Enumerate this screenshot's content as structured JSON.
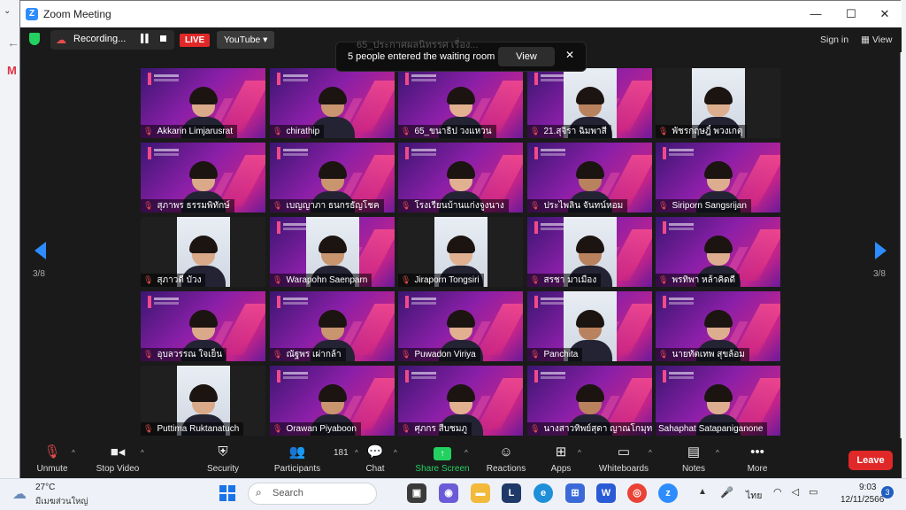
{
  "window": {
    "title": "Zoom Meeting"
  },
  "topbar": {
    "recording_label": "Recording...",
    "live_badge": "LIVE",
    "stream_target": "YouTube ▾",
    "sign_in": "Sign in",
    "view": "View"
  },
  "notification": {
    "ghost_text": "65_ประกาศผลนิทรรศ เรื่อง...",
    "text": "5 people entered the waiting room",
    "view_button": "View",
    "close": "✕"
  },
  "pagination": {
    "left": "3/8",
    "right": "3/8"
  },
  "participants": [
    {
      "name": "Akkarin Limjarusrat",
      "bg": "purple",
      "mic_muted": true
    },
    {
      "name": "chirathip",
      "bg": "purple",
      "mic_muted": true
    },
    {
      "name": "65_ขนาธิป วงแหวน",
      "bg": "purple",
      "mic_muted": true
    },
    {
      "name": "21.สุจิรา ฉิมพาสี",
      "bg": "purple-cam",
      "mic_muted": true
    },
    {
      "name": "พัชรกฤษฎิ์ พวงเกตุ",
      "bg": "plain-cam",
      "mic_muted": true
    },
    {
      "name": "สุภาพร ธรรมพิทักษ์",
      "bg": "purple",
      "mic_muted": true
    },
    {
      "name": "เบญญาภา ธนกรธัญโชค",
      "bg": "purple",
      "mic_muted": true
    },
    {
      "name": "โรงเรียนบ้านแก่งจูงนาง",
      "bg": "purple",
      "mic_muted": true
    },
    {
      "name": "ประไพลิน จันทน์หอม",
      "bg": "purple",
      "mic_muted": true
    },
    {
      "name": "Siriporn Sangsrijan",
      "bg": "purple",
      "mic_muted": true
    },
    {
      "name": "สุภาวดี บัวง",
      "bg": "plain-cam",
      "mic_muted": true
    },
    {
      "name": "Warapohn Saenparn",
      "bg": "purple-cam",
      "mic_muted": true
    },
    {
      "name": "Jiraporn Tongsiri",
      "bg": "plain-cam",
      "mic_muted": true
    },
    {
      "name": "สรชา มาเมือง",
      "bg": "purple-cam",
      "mic_muted": true
    },
    {
      "name": "พรทิพา หล้าคิดดี",
      "bg": "purple",
      "mic_muted": true
    },
    {
      "name": "อุบลวรรณ ใจเย็น",
      "bg": "purple",
      "mic_muted": true
    },
    {
      "name": "ณัฐพร เผ่ากล้า",
      "bg": "purple",
      "mic_muted": true
    },
    {
      "name": "Puwadon Viriya",
      "bg": "purple",
      "mic_muted": true
    },
    {
      "name": "Panchita",
      "bg": "purple-cam",
      "mic_muted": true
    },
    {
      "name": "นายทัตเทพ สุขล้อม",
      "bg": "purple",
      "mic_muted": true
    },
    {
      "name": "Puttima Ruktanatuch",
      "bg": "plain-cam",
      "mic_muted": true
    },
    {
      "name": "Orawan Piyaboon",
      "bg": "purple",
      "mic_muted": true
    },
    {
      "name": "ศุภกร สืบชมภู",
      "bg": "purple",
      "mic_muted": true
    },
    {
      "name": "นางสาวทิพย์สุดา ญาณโกมุท",
      "bg": "purple",
      "mic_muted": true
    },
    {
      "name": "Sahaphat Satapaniganone",
      "bg": "purple",
      "mic_muted": false
    }
  ],
  "controls": {
    "unmute": "Unmute",
    "stop_video": "Stop Video",
    "security": "Security",
    "participants": "Participants",
    "participant_count": "181",
    "chat": "Chat",
    "share_screen": "Share Screen",
    "reactions": "Reactions",
    "apps": "Apps",
    "whiteboards": "Whiteboards",
    "notes": "Notes",
    "more": "More",
    "leave": "Leave"
  },
  "taskbar": {
    "temperature": "27°C",
    "weather": "มีเมฆส่วนใหญ่",
    "search_placeholder": "Search",
    "language": "ไทย",
    "time": "9:03",
    "date": "12/11/2566",
    "notification_count": "3"
  },
  "colors": {
    "zoom_blue": "#2d8cff",
    "leave_red": "#e02828",
    "share_green": "#23d160",
    "tile_purple": "#8a1fa8"
  }
}
